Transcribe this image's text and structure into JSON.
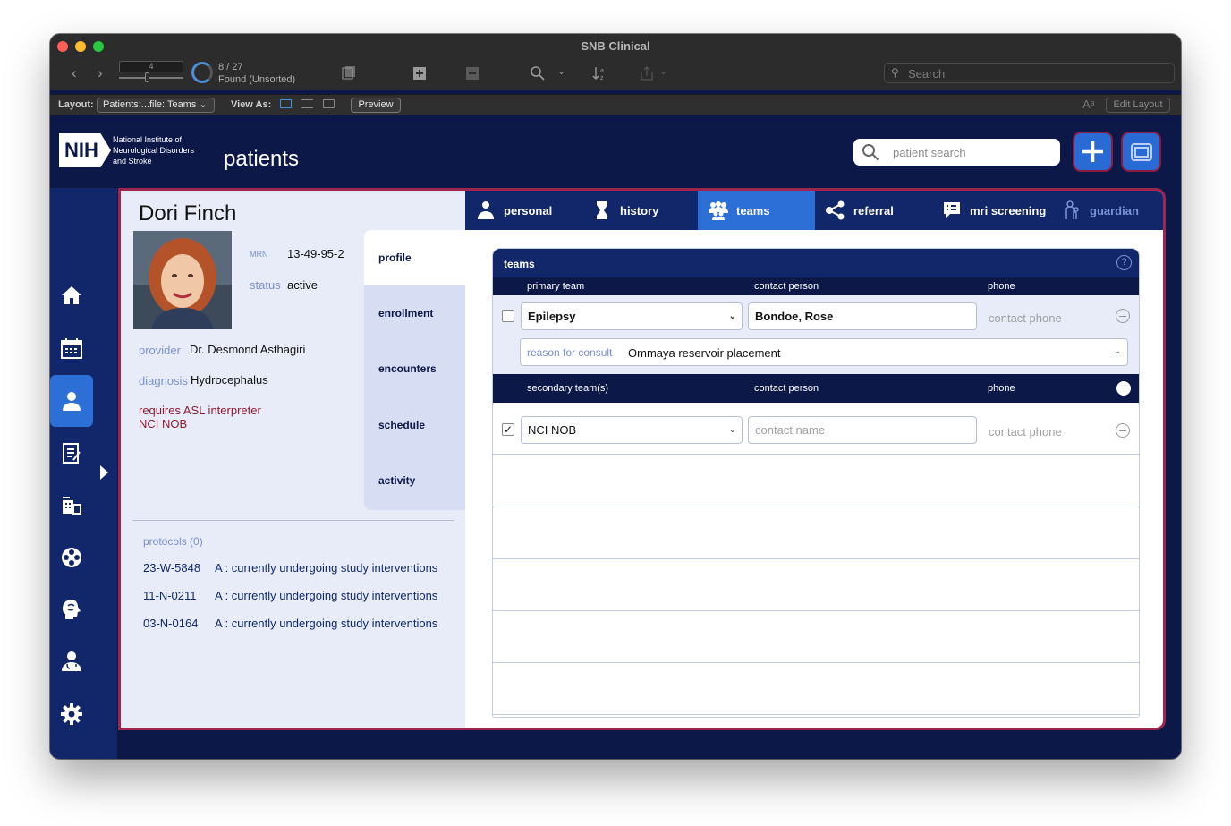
{
  "window": {
    "title": "SNB Clinical"
  },
  "toolbar": {
    "record_number": "4",
    "found_count": "8 / 27",
    "found_label": "Found (Unsorted)",
    "search_placeholder": "Search"
  },
  "layout_bar": {
    "layout_label": "Layout:",
    "layout_value": "Patients:...file: Teams",
    "view_as_label": "View As:",
    "preview_label": "Preview",
    "edit_layout_label": "Edit Layout"
  },
  "header": {
    "logo_text": "NIH",
    "org_name_lines": [
      "National Institute of",
      "Neurological Disorders",
      "and Stroke"
    ],
    "app_title": "patients",
    "search_placeholder": "patient search"
  },
  "sidebar": {
    "items": [
      "home-icon",
      "calendar-icon",
      "patient-icon",
      "clipboard-icon",
      "building-icon",
      "film-reel-icon",
      "brain-head-icon",
      "doctor-icon",
      "gear-icon"
    ],
    "active_index": 2
  },
  "patient": {
    "name": "Dori Finch",
    "mrn_label": "MRN",
    "mrn": "13-49-95-2",
    "status_label": "status",
    "status": "active",
    "provider_label": "provider",
    "provider": "Dr. Desmond Asthagiri",
    "diagnosis_label": "diagnosis",
    "diagnosis": "Hydrocephalus",
    "alerts": [
      "requires ASL interpreter",
      "NCI NOB"
    ]
  },
  "subnav": {
    "items": [
      "profile",
      "enrollment",
      "encounters",
      "schedule",
      "activity"
    ],
    "active_index": 0
  },
  "protocols": {
    "title": "protocols (0)",
    "rows": [
      {
        "id": "23-W-5848",
        "status": "A : currently undergoing study interventions"
      },
      {
        "id": "11-N-0211",
        "status": "A : currently undergoing study interventions"
      },
      {
        "id": "03-N-0164",
        "status": "A : currently undergoing study interventions"
      }
    ]
  },
  "tabs": {
    "items": [
      {
        "label": "personal",
        "icon": "doctor-icon"
      },
      {
        "label": "history",
        "icon": "hourglass-icon"
      },
      {
        "label": "teams",
        "icon": "team-icon"
      },
      {
        "label": "referral",
        "icon": "share-icon"
      },
      {
        "label": "mri screening",
        "icon": "mri-chat-icon"
      },
      {
        "label": "guardian",
        "icon": "guardian-icon"
      }
    ],
    "active_index": 2
  },
  "teams": {
    "title": "teams",
    "primary_header": {
      "col1": "primary team",
      "col2": "contact person",
      "col3": "phone"
    },
    "primary": {
      "checked": false,
      "team": "Epilepsy",
      "contact": "Bondoe, Rose",
      "phone_placeholder": "contact phone",
      "reason_label": "reason for consult",
      "reason_value": "Ommaya reservoir placement"
    },
    "secondary_header": {
      "col1": "secondary team(s)",
      "col2": "contact person",
      "col3": "phone"
    },
    "secondary": [
      {
        "checked": true,
        "team": "NCI NOB",
        "contact_placeholder": "contact name",
        "phone_placeholder": "contact phone"
      }
    ]
  },
  "colors": {
    "navy": "#0b1848",
    "sidebar": "#12266a",
    "accent_blue": "#2c6fd6",
    "maroon": "#a0254e",
    "alert_red": "#8e1a2e"
  }
}
